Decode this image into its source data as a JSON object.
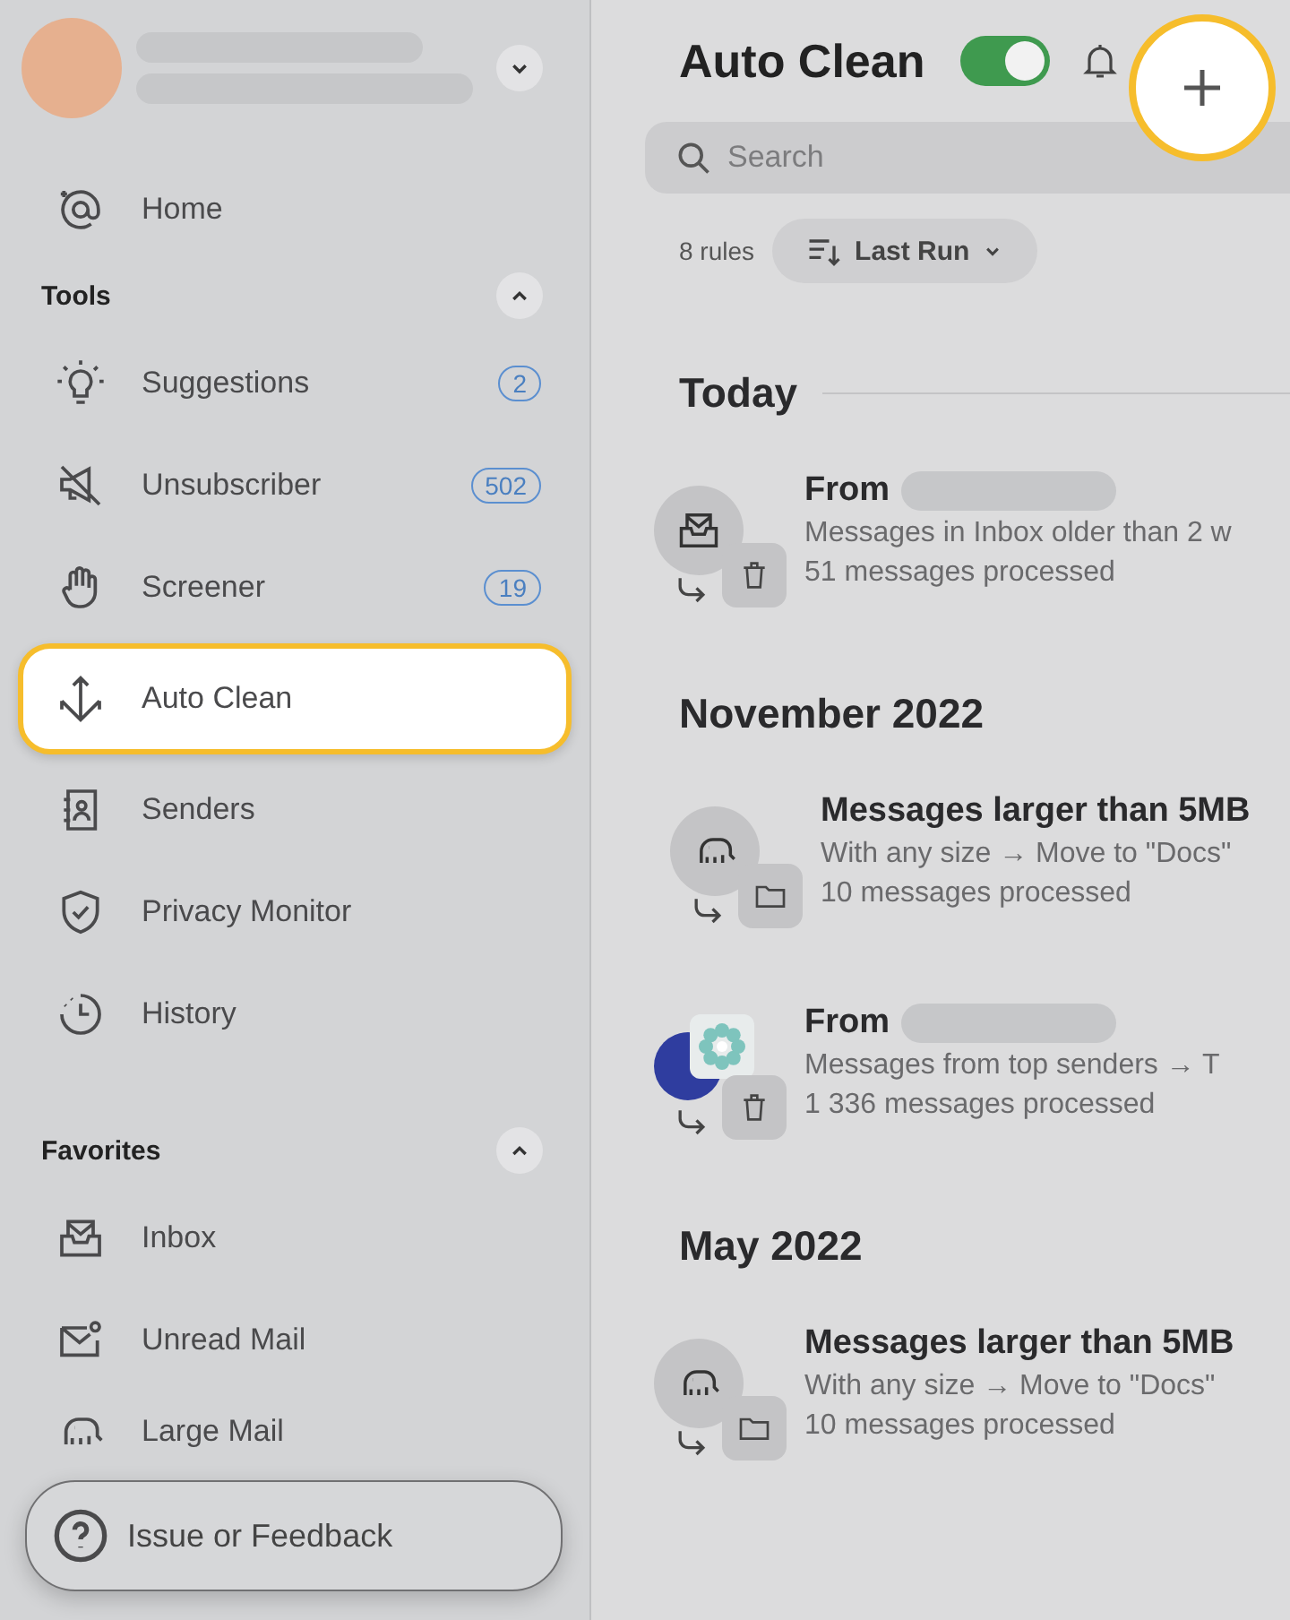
{
  "account": {
    "expanded": false
  },
  "sidebar": {
    "items": [
      {
        "label": "Home",
        "selected": false
      }
    ],
    "sections": [
      {
        "title": "Tools",
        "expanded": true,
        "items": [
          {
            "label": "Suggestions",
            "badge": "2",
            "selected": false
          },
          {
            "label": "Unsubscriber",
            "badge": "502",
            "selected": false
          },
          {
            "label": "Screener",
            "badge": "19",
            "selected": false
          },
          {
            "label": "Auto Clean",
            "selected": true
          },
          {
            "label": "Senders",
            "selected": false
          },
          {
            "label": "Privacy Monitor",
            "selected": false
          },
          {
            "label": "History",
            "selected": false
          }
        ]
      },
      {
        "title": "Favorites",
        "expanded": true,
        "items": [
          {
            "label": "Inbox",
            "selected": false
          },
          {
            "label": "Unread Mail",
            "selected": false
          },
          {
            "label": "Large Mail",
            "selected": false
          }
        ]
      }
    ],
    "feedback_button": "Issue or Feedback"
  },
  "header": {
    "title": "Auto Clean",
    "enabled": true
  },
  "search": {
    "placeholder": "Search"
  },
  "toolbar": {
    "count": "8 rules",
    "sort": "Last Run"
  },
  "groups": [
    {
      "title": "Today",
      "rules": [
        {
          "kind": "sender",
          "title": "From",
          "description": "Messages in Inbox older than 2 w",
          "processed": "51 messages processed"
        }
      ]
    },
    {
      "title": "November 2022",
      "rules": [
        {
          "kind": "size",
          "title": "Messages larger than 5MB",
          "description": "With any size → Move to \"Docs\"",
          "processed": "10 messages processed"
        },
        {
          "kind": "sender",
          "title": "From",
          "description": "Messages from top senders → T",
          "processed": "1 336 messages processed"
        }
      ]
    },
    {
      "title": "May 2022",
      "rules": [
        {
          "kind": "size",
          "title": "Messages larger than 5MB",
          "description": "With any size → Move to \"Docs\"",
          "processed": "10 messages processed"
        }
      ]
    }
  ]
}
